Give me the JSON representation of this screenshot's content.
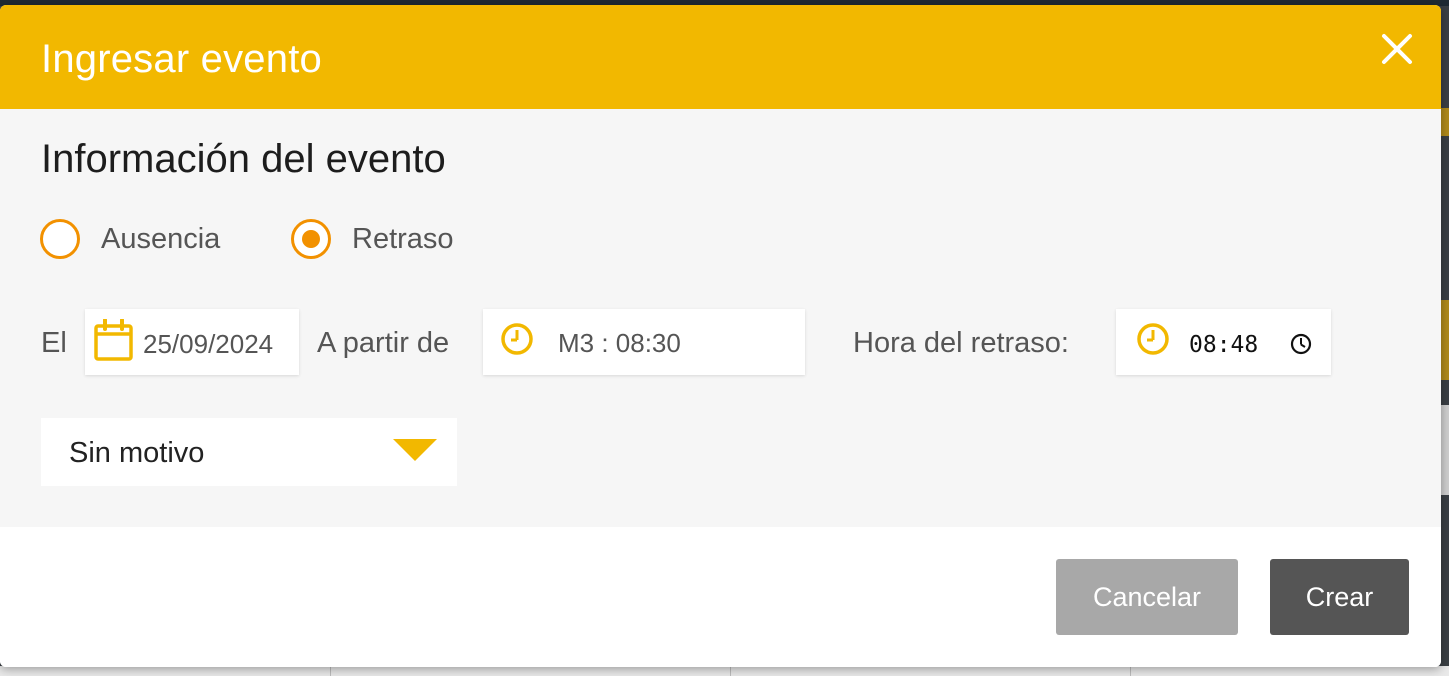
{
  "dialog": {
    "title": "Ingresar evento",
    "close_icon": "close-icon"
  },
  "section": {
    "title": "Información del evento"
  },
  "event_type": {
    "options": [
      {
        "label": "Ausencia",
        "selected": false
      },
      {
        "label": "Retraso",
        "selected": true
      }
    ]
  },
  "fields": {
    "date_label": "El",
    "date_value": "25/09/2024",
    "date_icon": "calendar-icon",
    "from_label": "A partir de",
    "from_value": "M3 : 08:30",
    "from_icon": "clock-icon",
    "delay_label": "Hora del retraso:",
    "delay_value": "08:48",
    "delay_icon": "clock-icon"
  },
  "reason": {
    "value": "Sin motivo",
    "icon": "caret-down-icon"
  },
  "buttons": {
    "cancel": "Cancelar",
    "create": "Crear"
  },
  "colors": {
    "header": "#f2b800",
    "radio_accent": "#f29100",
    "cancel_button": "#a8a8a8",
    "create_button": "#555555"
  }
}
